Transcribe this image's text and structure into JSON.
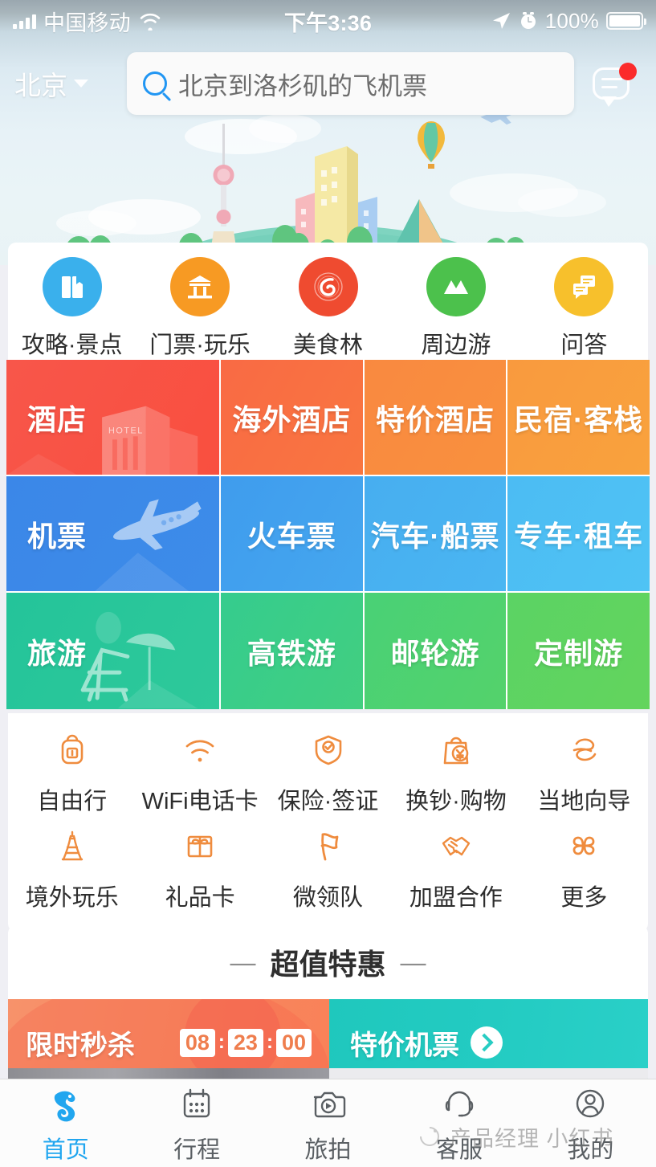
{
  "status_bar": {
    "carrier": "中国移动",
    "time": "下午3:36",
    "battery_percent": "100%",
    "signal_icon": "signal-bars-icon",
    "wifi_icon": "wifi-icon",
    "location_icon": "location-arrow-icon",
    "alarm_icon": "alarm-clock-icon",
    "battery_icon": "battery-full-icon"
  },
  "header": {
    "city": "北京",
    "city_chevron_icon": "chevron-down-icon",
    "search_value": "北京到洛杉矶的飞机票",
    "search_icon": "search-icon",
    "message_icon": "message-bubble-icon",
    "badge_icon": "notification-dot-icon"
  },
  "quick_icons": [
    {
      "label": "攻略·景点",
      "icon": "guidebook-icon",
      "color": "#3ab0ec"
    },
    {
      "label": "门票·玩乐",
      "icon": "pavilion-ticket-icon",
      "color": "#f79a23"
    },
    {
      "label": "美食林",
      "icon": "gourmet-forest-icon",
      "color": "#ef4b30"
    },
    {
      "label": "周边游",
      "icon": "mountain-icon",
      "color": "#4cc14c"
    },
    {
      "label": "问答",
      "icon": "qa-chat-icon",
      "color": "#f7c02c"
    }
  ],
  "tiles": {
    "rows": [
      {
        "big": {
          "label": "酒店",
          "color_from": "#f8564a",
          "color_to": "#f94f3f",
          "art": "hotel-building-art"
        },
        "cells": [
          {
            "label": "海外酒店",
            "color_from": "#f96a44",
            "color_to": "#f97640"
          },
          {
            "label": "特价酒店",
            "color_from": "#f98940",
            "color_to": "#f9913e"
          },
          {
            "label": "民宿·客栈",
            "color_from": "#f99a3e",
            "color_to": "#f9a23d"
          }
        ]
      },
      {
        "big": {
          "label": "机票",
          "color_from": "#3b87e8",
          "color_to": "#3d8ce9",
          "art": "airplane-art"
        },
        "cells": [
          {
            "label": "火车票",
            "color_from": "#3f9ced",
            "color_to": "#45a7ef"
          },
          {
            "label": "汽车·船票",
            "color_from": "#47aef0",
            "color_to": "#4ab6f2"
          },
          {
            "label": "专车·租车",
            "color_from": "#4cbcf3",
            "color_to": "#4fc3f4"
          }
        ]
      },
      {
        "big": {
          "label": "旅游",
          "color_from": "#24c49a",
          "color_to": "#2ec99a",
          "art": "beach-chair-art"
        },
        "cells": [
          {
            "label": "高铁游",
            "color_from": "#35cc8e",
            "color_to": "#42cf80"
          },
          {
            "label": "邮轮游",
            "color_from": "#49d176",
            "color_to": "#54d26b"
          },
          {
            "label": "定制游",
            "color_from": "#5bd364",
            "color_to": "#63d45d"
          }
        ]
      }
    ]
  },
  "service_icons_row1": [
    {
      "label": "自由行",
      "icon": "backpack-icon"
    },
    {
      "label": "WiFi电话卡",
      "icon": "wifi-signal-icon"
    },
    {
      "label": "保险·签证",
      "icon": "shield-check-icon"
    },
    {
      "label": "换钞·购物",
      "icon": "shopping-bag-yuan-icon"
    },
    {
      "label": "当地向导",
      "icon": "local-guide-icon"
    }
  ],
  "service_icons_row2": [
    {
      "label": "境外玩乐",
      "icon": "eiffel-tower-icon"
    },
    {
      "label": "礼品卡",
      "icon": "gift-card-icon"
    },
    {
      "label": "微领队",
      "icon": "flag-icon"
    },
    {
      "label": "加盟合作",
      "icon": "handshake-icon"
    },
    {
      "label": "更多",
      "icon": "more-grid-icon"
    }
  ],
  "promo": {
    "title": "超值特惠",
    "left_dash": "—",
    "right_dash": "—",
    "seckill": {
      "label": "限时秒杀",
      "hours": "08",
      "minutes": "23",
      "seconds": "00",
      "separator": ":"
    },
    "cheap_flights": {
      "label": "特价机票",
      "arrow_icon": "chevron-right-circle-icon"
    }
  },
  "tabbar": [
    {
      "label": "首页",
      "icon": "qunar-camel-home-icon",
      "active": true
    },
    {
      "label": "行程",
      "icon": "calendar-icon",
      "active": false
    },
    {
      "label": "旅拍",
      "icon": "camera-icon",
      "active": false
    },
    {
      "label": "客服",
      "icon": "headset-support-icon",
      "active": false
    },
    {
      "label": "我的",
      "icon": "user-profile-icon",
      "active": false
    }
  ],
  "watermark": {
    "text": "产品经理 小红书",
    "logo_icon": "watermark-logo-icon"
  },
  "theme": {
    "accent_blue": "#21a6ef",
    "accent_orange": "#ef8c3e",
    "badge_red": "#fb2b2b",
    "page_bg": "#efeff4"
  }
}
